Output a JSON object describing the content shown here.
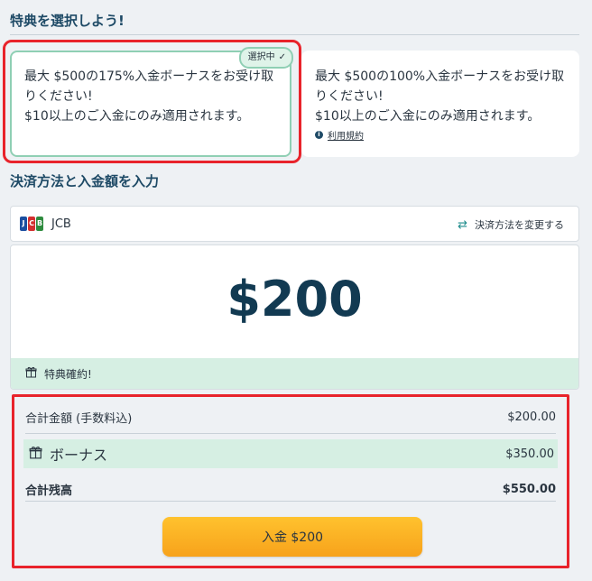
{
  "bonus_section": {
    "title": "特典を選択しよう!",
    "option_a": {
      "badge": "選択中",
      "line1": "最大 $500の175%入金ボーナスをお受け取りください!",
      "line2": "$10以上のご入金にのみ適用されます。"
    },
    "option_b": {
      "line1": "最大 $500の100%入金ボーナスをお受け取りください!",
      "line2": "$10以上のご入金にのみ適用されます。",
      "terms": "利用規約"
    }
  },
  "payment_section": {
    "title": "決済方法と入金額を入力",
    "method": "JCB",
    "change_label": "決済方法を変更する",
    "amount": "$200",
    "bonus_confirmed": "特典確約!"
  },
  "summary": {
    "total_label": "合計金額 (手数料込)",
    "total_value": "$200.00",
    "bonus_label": "ボーナス",
    "bonus_value": "$350.00",
    "balance_label": "合計残高",
    "balance_value": "$550.00",
    "deposit_button": "入金 $200"
  },
  "colors": {
    "accent_green": "#8fcfb4",
    "highlight_red": "#e8232b",
    "button_orange": "#f7a21b",
    "title_blue": "#1e4a66"
  }
}
